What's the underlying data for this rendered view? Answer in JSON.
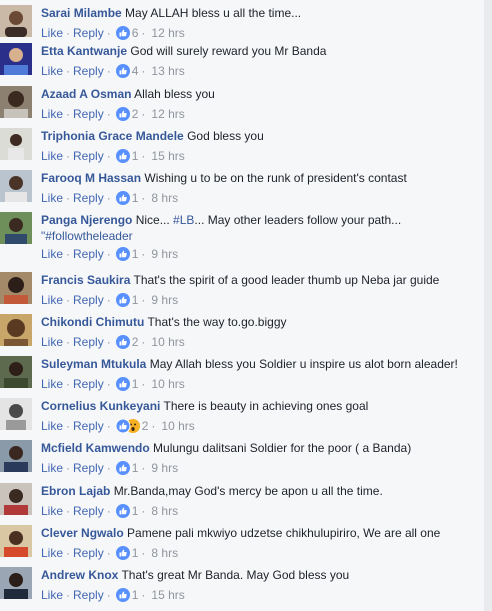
{
  "actions": {
    "like": "Like",
    "reply": "Reply",
    "sep": "·"
  },
  "comments": [
    {
      "author": "Sarai Milambe",
      "text": "May ALLAH bless u all the time...",
      "reaction": "like-icon",
      "count": "6",
      "time": "12 hrs"
    },
    {
      "author": "Etta Kantwanje",
      "text": "God will surely reward you Mr Banda",
      "reaction": "like-icon",
      "count": "4",
      "time": "13 hrs"
    },
    {
      "author": "Azaad A Osman",
      "text": "Allah bless you",
      "reaction": "like-icon",
      "count": "2",
      "time": "12 hrs"
    },
    {
      "author": "Triphonia Grace Mandele",
      "text": "God bless you",
      "reaction": "like-icon",
      "count": "1",
      "time": "15 hrs"
    },
    {
      "author": "Farooq M Hassan",
      "text": "Wishing u to be on the runk of president's contast",
      "reaction": "like-icon",
      "count": "1",
      "time": "8 hrs"
    },
    {
      "author": "Panga Njerengo",
      "text_a": "Nice... ",
      "hashtag_a": "#LB",
      "text_b": "... May other leaders follow your path...",
      "hashtag_b": "\"#followtheleader",
      "reaction": "like-icon",
      "count": "1",
      "time": "9 hrs"
    },
    {
      "author": "Francis Saukira",
      "text": "That's the spirit of a good leader thumb up Neba jar guide",
      "reaction": "like-icon",
      "count": "1",
      "time": "9 hrs"
    },
    {
      "author": "Chikondi Chimutu",
      "text": "That's the way to.go.biggy",
      "reaction": "like-icon",
      "count": "2",
      "time": "10 hrs"
    },
    {
      "author": "Suleyman Mtukula",
      "text": "May Allah bless you Soldier u inspire us alot born aleader!",
      "reaction": "like-icon",
      "count": "1",
      "time": "10 hrs"
    },
    {
      "author": "Cornelius Kunkeyani",
      "text": "There is beauty in achieving ones goal",
      "reaction": "like-and-wow-icons",
      "count": "2",
      "time": "10 hrs"
    },
    {
      "author": "Mcfield Kamwendo",
      "text": "Mulungu dalitsani Soldier for the poor ( a Banda)",
      "reaction": "like-icon",
      "count": "1",
      "time": "9 hrs"
    },
    {
      "author": "Ebron Lajab",
      "text": "Mr.Banda,may God's mercy be apon u all the time.",
      "reaction": "like-icon",
      "count": "1",
      "time": "8 hrs"
    },
    {
      "author": "Clever Ngwalo",
      "text": "Pamene pali mkwiyo udzetse chikhulupiriro, We are all one",
      "reaction": "like-icon",
      "count": "1",
      "time": "8 hrs"
    },
    {
      "author": "Andrew Knox",
      "text": "That's great Mr Banda. May God bless you",
      "reaction": "like-icon",
      "count": "1",
      "time": "15 hrs"
    }
  ],
  "colors": {
    "author": "#365899",
    "link": "#4267b2",
    "meta": "#90949c",
    "like_badge": "#5890ff",
    "background": "#f6f7f9"
  }
}
